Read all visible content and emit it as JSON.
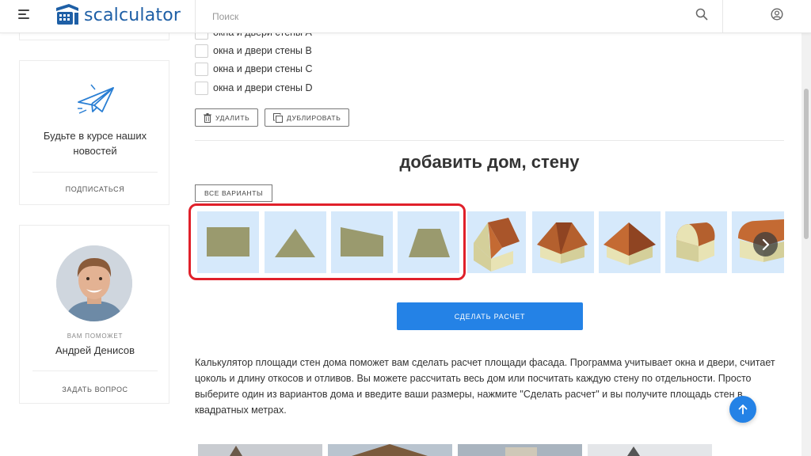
{
  "header": {
    "logo_text": "scalculator",
    "search_placeholder": "Поиск",
    "icons": [
      "menu-icon",
      "search-icon",
      "user-icon"
    ]
  },
  "sidebar": {
    "newsletter": {
      "text": "Будьте в курсе наших новостей",
      "link": "ПОДПИСАТЬСЯ",
      "icon": "paper-plane-icon"
    },
    "helper": {
      "label": "ВАМ ПОМОЖЕТ",
      "name": "Андрей Денисов",
      "link": "ЗАДАТЬ ВОПРОС"
    }
  },
  "walls": {
    "items": [
      {
        "label": "окна и двери стены A"
      },
      {
        "label": "окна и двери стены B"
      },
      {
        "label": "окна и двери стены C"
      },
      {
        "label": "окна и двери стены D"
      }
    ],
    "delete_label": "УДАЛИТЬ",
    "duplicate_label": "ДУБЛИРОВАТЬ"
  },
  "add_section": {
    "title": "добавить дом, стену",
    "all_variants_label": "ВСЕ ВАРИАНТЫ",
    "shapes": [
      "rectangle",
      "triangle",
      "trapezoid-slanted",
      "trapezoid"
    ],
    "houses": [
      "gable-roof-house",
      "hip-roof-house",
      "pyramid-roof-house",
      "mansard-roof-house",
      "shed-house"
    ],
    "tile_color": "#d6e9fb",
    "shape_color": "#9a9a6e",
    "highlight_color": "#e0202a"
  },
  "calculate_label": "СДЕЛАТЬ РАСЧЕТ",
  "description": "Калькулятор площади стен дома поможет вам сделать расчет площади фасада. Программа учитывает окна и двери, считает цоколь и длину откосов и отливов. Вы можете рассчитать весь дом или посчитать каждую стену по отдельности. Просто выберите один из вариантов дома и введите ваши размеры, нажмите \"Сделать расчет\" и вы получите площадь стен в квадратных метрах.",
  "accent_color": "#2482e6"
}
